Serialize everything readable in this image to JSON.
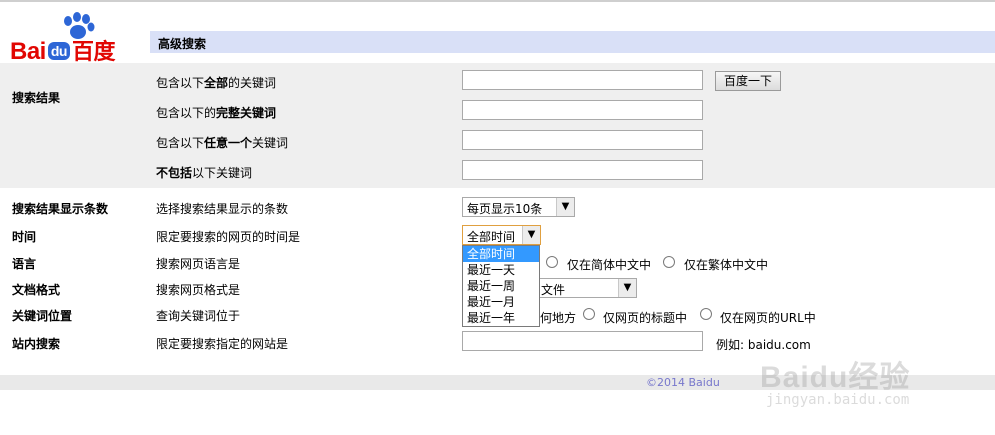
{
  "logo": {
    "bai": "Bai",
    "du": "du",
    "cn": "百度"
  },
  "header": {
    "title": "高级搜索"
  },
  "search_results": {
    "category": "搜索结果",
    "rows": [
      {
        "pre": "包含以下",
        "bold": "全部",
        "post": "的关键词"
      },
      {
        "pre": "包含以下的",
        "bold": "完整关键词",
        "post": ""
      },
      {
        "pre": "包含以下",
        "bold": "任意一个",
        "post": "关键词"
      },
      {
        "pre": "",
        "bold": "不包括",
        "post": "以下关键词"
      }
    ],
    "button_label": "百度一下"
  },
  "result_count": {
    "category": "搜索结果显示条数",
    "desc": "选择搜索结果显示的条数",
    "selected": "每页显示10条"
  },
  "time": {
    "category": "时间",
    "desc": "限定要搜索的网页的时间是",
    "selected": "全部时间",
    "options": [
      "全部时间",
      "最近一天",
      "最近一周",
      "最近一月",
      "最近一年"
    ]
  },
  "language": {
    "category": "语言",
    "desc": "搜索网页语言是",
    "options": [
      "仅在简体中文中",
      "仅在繁体中文中"
    ]
  },
  "format": {
    "category": "文档格式",
    "desc": "搜索网页格式是",
    "selected_partial": "文件"
  },
  "position": {
    "category": "关键词位置",
    "desc": "查询关键词位于",
    "partial": "何地方",
    "options": [
      "仅网页的标题中",
      "仅在网页的URL中"
    ]
  },
  "site": {
    "category": "站内搜索",
    "desc": "限定要搜索指定的网站是",
    "example": "例如: baidu.com"
  },
  "footer": {
    "copyright": "©2014 Baidu"
  },
  "watermark": {
    "main": "Baidu经验",
    "sub": "jingyan.baidu.com"
  }
}
